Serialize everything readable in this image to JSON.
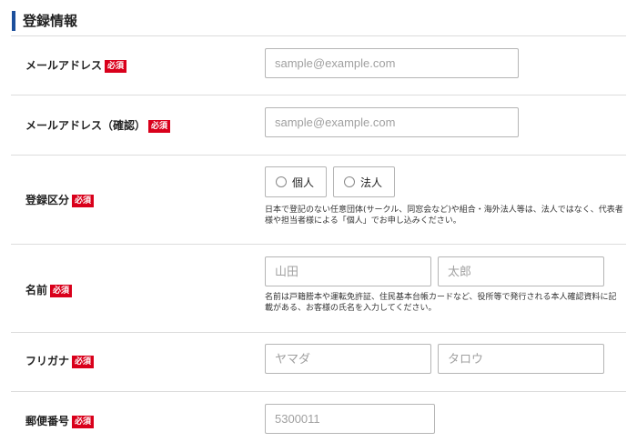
{
  "section": {
    "title": "登録情報"
  },
  "required_badge": "必須",
  "fields": {
    "email": {
      "label": "メールアドレス",
      "placeholder": "sample@example.com",
      "value": ""
    },
    "email_confirm": {
      "label": "メールアドレス（確認）",
      "placeholder": "sample@example.com",
      "value": ""
    },
    "registration_type": {
      "label": "登録区分",
      "options": [
        "個人",
        "法人"
      ],
      "note": "日本で登記のない任意団体(サークル、同窓会など)や組合・海外法人等は、法人ではなく、代表者様や担当者様による「個人」でお申し込みください。"
    },
    "name": {
      "label": "名前",
      "last_placeholder": "山田",
      "first_placeholder": "太郎",
      "note": "名前は戸籍謄本や運転免許証、住民基本台帳カードなど、役所等で発行される本人確認資料に記載がある、お客様の氏名を入力してください。"
    },
    "furigana": {
      "label": "フリガナ",
      "last_placeholder": "ヤマダ",
      "first_placeholder": "タロウ"
    },
    "postal_code": {
      "label": "郵便番号",
      "placeholder": "5300011"
    }
  },
  "colors": {
    "accent": "#1c4f9c",
    "required": "#d9001b",
    "border": "#b5b5b5",
    "divider": "#dcdcdc"
  }
}
